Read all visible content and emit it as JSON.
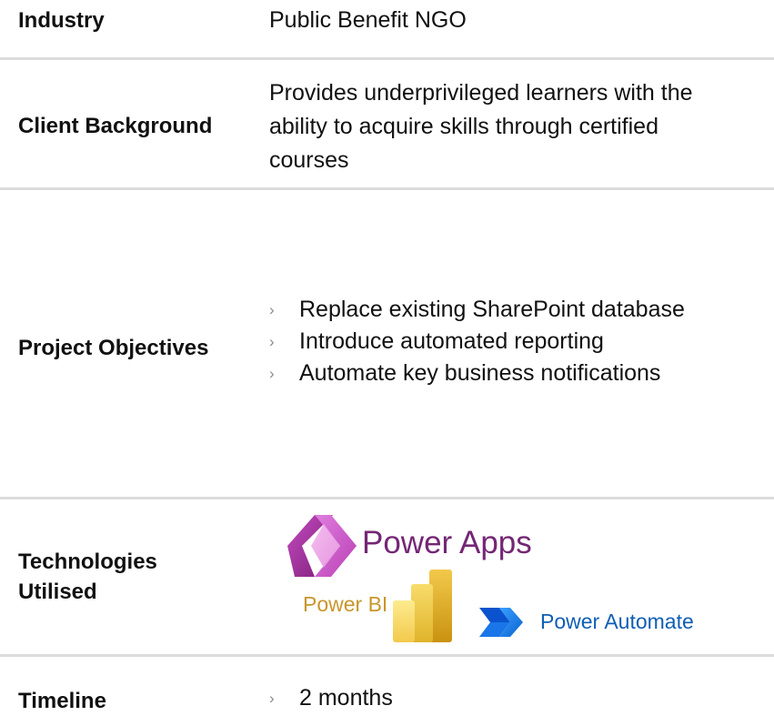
{
  "rows": {
    "industry": {
      "label": "Industry",
      "value": "Public Benefit NGO"
    },
    "client_background": {
      "label": "Client Background",
      "lines": [
        "Provides underprivileged learners with the",
        "ability to acquire skills through certified",
        "courses"
      ]
    },
    "project_objectives": {
      "label": "Project Objectives",
      "bullets": [
        "Replace existing SharePoint database",
        "Introduce automated reporting",
        "Automate key business notifications"
      ]
    },
    "technologies": {
      "label_lines": [
        "Technologies",
        "Utilised"
      ],
      "logos": {
        "power_apps": "Power Apps",
        "power_bi": "Power BI",
        "power_automate": "Power Automate"
      },
      "icons": [
        "power-apps-icon",
        "power-bi-icon",
        "power-automate-icon"
      ]
    },
    "timeline": {
      "label": "Timeline",
      "bullets": [
        "2 months"
      ]
    }
  },
  "colors": {
    "divider": "#dcdcdc",
    "power_apps_text": "#742774",
    "power_bi_text": "#c8962a",
    "power_automate_text": "#0f5eb4",
    "chevron": "#8a8a8a"
  }
}
